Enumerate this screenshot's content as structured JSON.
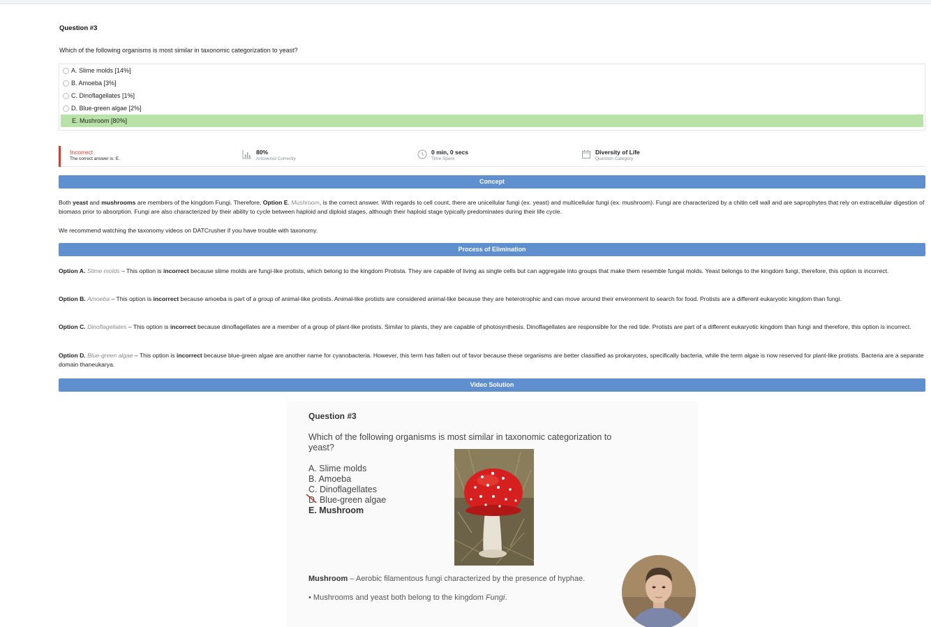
{
  "question": {
    "title": "Question #3",
    "text": "Which of the following organisms is most similar in taxonomic categorization to yeast?"
  },
  "answers": [
    {
      "label": "A. Slime molds [14%]"
    },
    {
      "label": "B. Amoeba [3%]"
    },
    {
      "label": "C. Dinoflagellates [1%]"
    },
    {
      "label": "D. Blue-green algae [2%]"
    },
    {
      "label": "E. Mushroom [80%]"
    }
  ],
  "stats": {
    "result": {
      "main": "Incorrect",
      "sub": "The correct answer is: E."
    },
    "percent": {
      "main": "80%",
      "sub": "Answered Correctly"
    },
    "time": {
      "main": "0 min, 0 secs",
      "sub": "Time Spent"
    },
    "category": {
      "main": "Diversity of Life",
      "sub": "Question Category"
    },
    "correct_answer_fraction": 0.8
  },
  "sections": {
    "concept": "Concept",
    "elimination": "Process of Elimination",
    "video": "Video Solution"
  },
  "concept": {
    "p1a": "Both ",
    "p1b": "yeast",
    "p1c": " and ",
    "p1d": "mushrooms",
    "p1e": " are members of the kingdom Fungi. Therefore, ",
    "p1f": "Option E",
    "p1g": ". ",
    "p1h": "Mushroom",
    "p1i": ", is the correct answer. With regards to cell count, there are unicellular fungi (ex. yeast) and multicellular fungi (ex. mushroom). Fungi are characterized by a chitin cell wall and are saprophytes that rely on extracellular digestion of biomass prior to absorption. Fungi are also characterized by their ability to cycle between haploid and diploid stages, although their haploid stage typically predominates during their life cycle.",
    "p2": "We recommend watching the taxonomy videos on DATCrusher if you have trouble with taxonomy."
  },
  "elimination": [
    {
      "opt": "Option A.",
      "name": "Slime molds",
      "dash": " – This option is ",
      "bold": "incorrect",
      "rest": " because slime molds are fungi-like protists, which belong to the kingdom Protista. They are capable of living as single cells but can aggregate into groups that make them resemble fungal molds. Yeast belongs to the kingdom fungi, therefore, this option is incorrect."
    },
    {
      "opt": "Option B.",
      "name": "Amoeba",
      "dash": " – This option is ",
      "bold": "incorrect",
      "rest": " because amoeba is part of a group of animal-like protists. Animal-like protists are considered animal-like because they are heterotrophic and can move around their environment to search for food. Protists are a different eukaryotic kingdom than fungi."
    },
    {
      "opt": "Option C.",
      "name": "Dinoflagellates",
      "dash": " – This option is ",
      "bold": "incorrect",
      "rest": " because dinoflagellates are a member of a group of plant-like protists. Similar to plants, they are capable of photosynthesis. Dinoflagellates are responsible for the red tide. Protists are part of a different eukaryotic kingdom than fungi and therefore, this option is incorrect."
    },
    {
      "opt": "Option D.",
      "name": "Blue-green algae",
      "dash": " – This option is ",
      "bold": "incorrect",
      "rest": " because blue-green algae are another name for cyanobacteria. However, this term has fallen out of favor because these organisms are better classified as prokaryotes, specifically bacteria, while the term algae is now reserved for plant-like protists. Bacteria are a separate domain thaneukarya."
    }
  ],
  "video": {
    "title": "Question #3",
    "question": "Which of the following organisms is most similar in taxonomic categorization to yeast?",
    "options": [
      "A. Slime molds",
      "B. Amoeba",
      "C. Dinoflagellates",
      "D. Blue-green algae",
      "E. Mushroom"
    ],
    "def_term": "Mushroom",
    "def_text": " – Aerobic filamentous fungi characterized by the presence of hyphae.",
    "bullet_a": "•  Mushrooms and yeast both belong to the kingdom ",
    "bullet_b": "Fungi",
    "bullet_c": "."
  },
  "colors": {
    "band": "#5f8fcf",
    "correct_highlight": "#b8e2a8",
    "incorrect": "#e0392f"
  }
}
